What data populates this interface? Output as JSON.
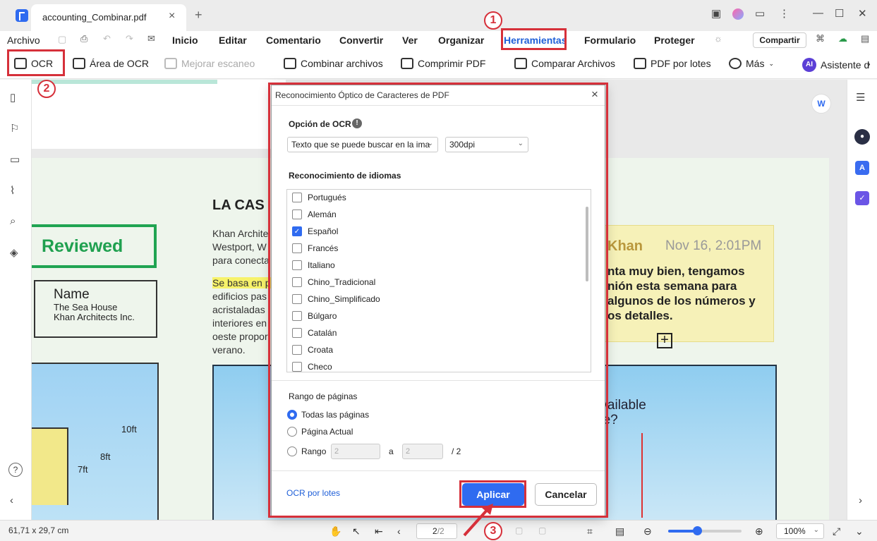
{
  "app": {
    "tab_title": "accounting_Combinar.pdf",
    "menu": [
      "Archivo",
      "Inicio",
      "Editar",
      "Comentario",
      "Convertir",
      "Ver",
      "Organizar",
      "Herramientas",
      "Formulario",
      "Proteger"
    ],
    "share": "Compartir"
  },
  "toolbar": {
    "ocr": "OCR",
    "area_ocr": "Área de OCR",
    "mejorar": "Mejorar escaneo",
    "combinar": "Combinar archivos",
    "comprimir": "Comprimir PDF",
    "comparar": "Comparar Archivos",
    "lotes": "PDF por lotes",
    "mas": "Más",
    "asistente": "Asistente d",
    "ai_badge": "AI"
  },
  "document": {
    "reviewed": "Reviewed",
    "name_title": "Name",
    "name_line1": "The Sea House",
    "name_line2": "Khan Architects Inc.",
    "heading": "LA CAS",
    "para1": [
      "Khan Archite",
      "Westport, W",
      "para conecta"
    ],
    "para2_hl": "Se basa en p",
    "para2": [
      "edificios pas",
      "acristaladas",
      "interiores en",
      "oeste propor",
      "verano."
    ],
    "note_author": "Khan",
    "note_date": "Nov 16, 2:01PM",
    "note_text": [
      "nta muy bien, tengamos",
      "nión esta semana para",
      "algunos de los números y",
      "os detalles."
    ],
    "question": [
      "e available",
      "osite?"
    ],
    "ft10": "10ft",
    "ft8": "8ft",
    "ft7": "7ft"
  },
  "dialog": {
    "title": "Reconocimiento Óptico de Caracteres de PDF",
    "ocr_option_label": "Opción de OCR",
    "ocr_mode": "Texto que se puede buscar en la ima",
    "dpi": "300dpi",
    "lang_label": "Reconocimiento de idiomas",
    "languages": [
      {
        "name": "Portugués",
        "checked": false
      },
      {
        "name": "Alemán",
        "checked": false
      },
      {
        "name": "Español",
        "checked": true
      },
      {
        "name": "Francés",
        "checked": false
      },
      {
        "name": "Italiano",
        "checked": false
      },
      {
        "name": "Chino_Tradicional",
        "checked": false
      },
      {
        "name": "Chino_Simplificado",
        "checked": false
      },
      {
        "name": "Búlgaro",
        "checked": false
      },
      {
        "name": "Catalán",
        "checked": false
      },
      {
        "name": "Croata",
        "checked": false
      },
      {
        "name": "Checo",
        "checked": false
      }
    ],
    "range_label": "Rango de páginas",
    "all_pages": "Todas las páginas",
    "current_page": "Página Actual",
    "range": "Rango",
    "range_from": "2",
    "range_to_label": "a",
    "range_to": "2",
    "range_total": "/ 2",
    "batch_link": "OCR por lotes",
    "apply": "Aplicar",
    "cancel": "Cancelar"
  },
  "status": {
    "dimensions": "61,71 x 29,7 cm",
    "page": "2",
    "page_total": "/2",
    "zoom": "100%",
    "zoom_level_percent": 100
  },
  "annotations": {
    "step1": "1",
    "step2": "2",
    "step3": "3"
  },
  "colors": {
    "accent": "#2f6bf0",
    "highlight_red": "#d6303a",
    "reviewed_green": "#20a452"
  }
}
